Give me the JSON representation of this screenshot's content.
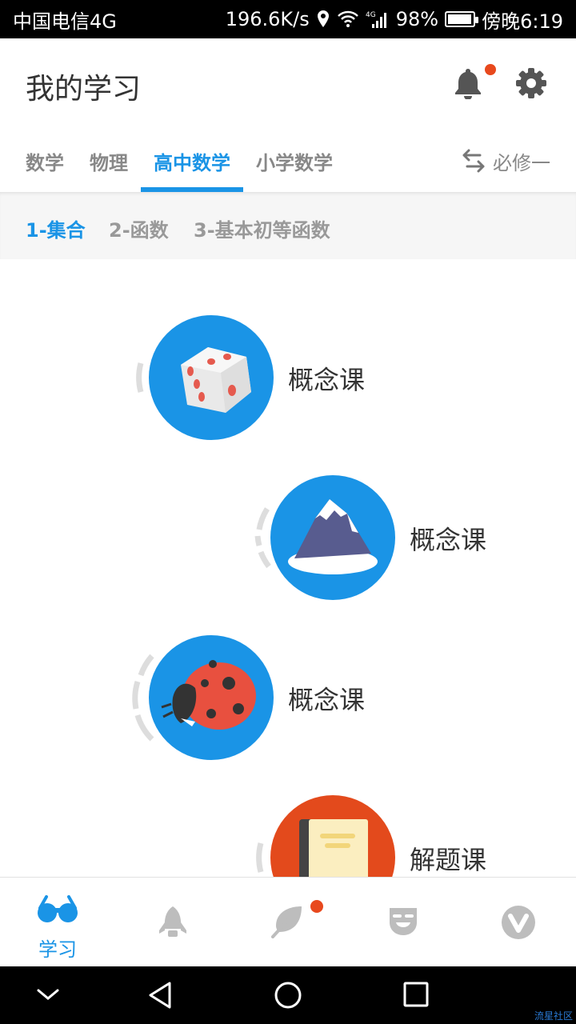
{
  "status": {
    "carrier": "中国电信4G",
    "speed": "196.6K/s",
    "battery": "98%",
    "time": "傍晚6:19",
    "battery_level": 0.98
  },
  "header": {
    "title": "我的学习",
    "bell_icon": "bell-icon",
    "settings_icon": "gear-icon"
  },
  "subject_tabs": {
    "items": [
      {
        "label": "数学"
      },
      {
        "label": "物理"
      },
      {
        "label": "高中数学"
      },
      {
        "label": "小学数学"
      }
    ],
    "active_index": 2,
    "switch_label": "必修一"
  },
  "chapters": {
    "items": [
      {
        "label": "1-集合"
      },
      {
        "label": "2-函数"
      },
      {
        "label": "3-基本初等函数"
      }
    ],
    "active_index": 0
  },
  "lessons": [
    {
      "label": "概念课",
      "icon": "dice-icon",
      "color": "#1a94e6"
    },
    {
      "label": "概念课",
      "icon": "mountain-icon",
      "color": "#1a94e6"
    },
    {
      "label": "概念课",
      "icon": "ladybug-icon",
      "color": "#1a94e6"
    },
    {
      "label": "解题课",
      "icon": "book-icon",
      "color": "#e34a1c"
    }
  ],
  "bottom_nav": {
    "items": [
      {
        "label": "学习",
        "icon": "glasses-icon"
      },
      {
        "label": "",
        "icon": "rocket-icon"
      },
      {
        "label": "",
        "icon": "leaf-icon"
      },
      {
        "label": "",
        "icon": "smile-face-icon"
      },
      {
        "label": "",
        "icon": "v-badge-icon"
      }
    ],
    "active_index": 0
  },
  "system_nav": {
    "back_icon": "back-triangle-icon",
    "home_icon": "home-circle-icon",
    "recents_icon": "recents-square-icon",
    "collapse_icon": "chevron-down-icon"
  },
  "watermark": "流星社区",
  "colors": {
    "accent": "#1a94e6",
    "alert": "#e8491d",
    "lesson_blue": "#1a94e6",
    "lesson_orange": "#e34a1c"
  }
}
